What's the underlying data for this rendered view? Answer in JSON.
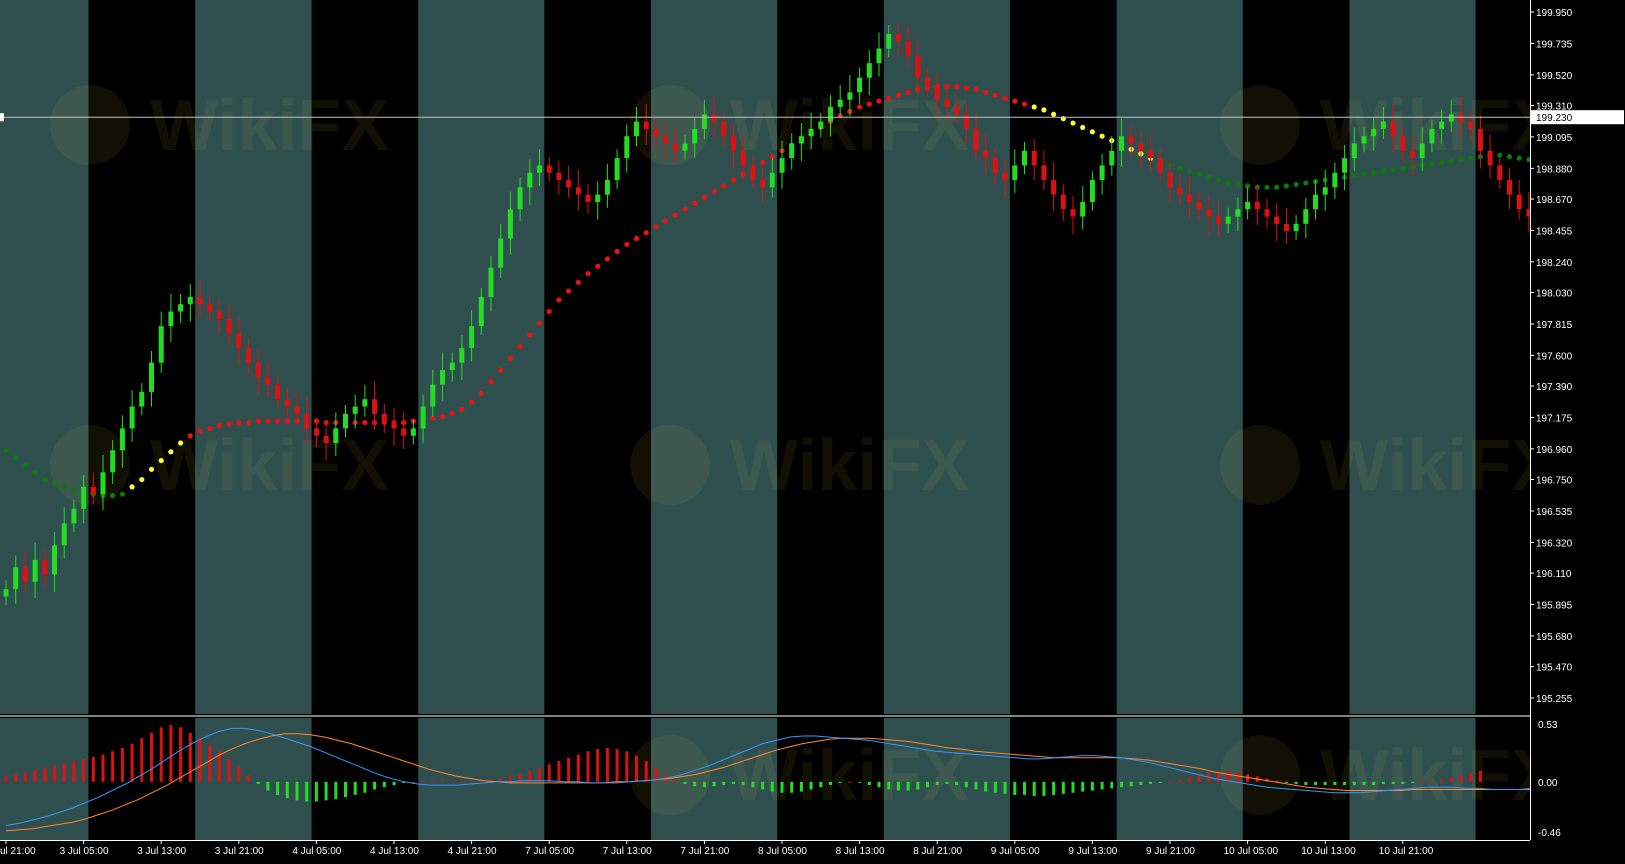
{
  "colors": {
    "session_band": "#2f4f4f",
    "off_band": "#000000",
    "bull_candle": "#22dd22",
    "bear_candle": "#dd1111",
    "trail_red": "#ee1111",
    "trail_yellow": "#ffff33",
    "trail_green": "#0a7a0a",
    "axis_text": "#ffffff",
    "macd_line": "#3399ff",
    "signal_line": "#ff8833",
    "hist_pos": "#dd1111",
    "hist_neg": "#22dd22"
  },
  "price_axis": {
    "ticks": [
      "199.950",
      "199.735",
      "199.520",
      "199.310",
      "199.095",
      "198.880",
      "198.670",
      "198.455",
      "198.240",
      "198.030",
      "197.815",
      "197.600",
      "197.390",
      "197.175",
      "196.960",
      "196.750",
      "196.535",
      "196.320",
      "196.110",
      "195.895",
      "195.680",
      "195.470",
      "195.255"
    ],
    "current_price": "199.230"
  },
  "macd_axis": {
    "ticks": [
      "0.53",
      "0.00",
      "-0.46"
    ]
  },
  "time_axis": {
    "labels": [
      "ul 21:00",
      "3 Jul 05:00",
      "3 Jul 13:00",
      "3 Jul 21:00",
      "4 Jul 05:00",
      "4 Jul 13:00",
      "4 Jul 21:00",
      "7 Jul 05:00",
      "7 Jul 13:00",
      "7 Jul 21:00",
      "8 Jul 05:00",
      "8 Jul 13:00",
      "8 Jul 21:00",
      "9 Jul 05:00",
      "9 Jul 13:00",
      "9 Jul 21:00",
      "10 Jul 05:00",
      "10 Jul 13:00",
      "10 Jul 21:00"
    ]
  },
  "watermark": "WikiFX",
  "chart_data": [
    {
      "type": "candlestick",
      "ylim": [
        195.255,
        199.95
      ],
      "current_price": 199.23,
      "x_labels": [
        "ul 21:00",
        "3 Jul 05:00",
        "3 Jul 13:00",
        "3 Jul 21:00",
        "4 Jul 05:00",
        "4 Jul 13:00",
        "4 Jul 21:00",
        "7 Jul 05:00",
        "7 Jul 13:00",
        "7 Jul 21:00",
        "8 Jul 05:00",
        "8 Jul 13:00",
        "8 Jul 21:00",
        "9 Jul 05:00",
        "9 Jul 13:00",
        "9 Jul 21:00",
        "10 Jul 05:00",
        "10 Jul 13:00",
        "10 Jul 21:00"
      ],
      "hours_per_label": 8,
      "sessions_dark": [
        [
          9,
          19
        ],
        [
          32,
          42
        ],
        [
          56,
          66
        ],
        [
          80,
          90
        ],
        [
          104,
          114
        ],
        [
          128,
          138
        ],
        [
          152,
          162
        ]
      ],
      "ohlc_close": [
        196.0,
        196.15,
        196.05,
        196.2,
        196.1,
        196.3,
        196.45,
        196.55,
        196.7,
        196.65,
        196.8,
        196.95,
        197.1,
        197.25,
        197.35,
        197.55,
        197.8,
        197.9,
        197.95,
        198.0,
        197.95,
        197.9,
        197.85,
        197.75,
        197.65,
        197.55,
        197.45,
        197.4,
        197.3,
        197.25,
        197.2,
        197.1,
        197.05,
        197.0,
        197.1,
        197.2,
        197.25,
        197.3,
        197.2,
        197.15,
        197.1,
        197.05,
        197.1,
        197.25,
        197.4,
        197.5,
        197.55,
        197.65,
        197.8,
        198.0,
        198.2,
        198.4,
        198.6,
        198.75,
        198.85,
        198.9,
        198.85,
        198.8,
        198.75,
        198.7,
        198.65,
        198.7,
        198.8,
        198.95,
        199.1,
        199.2,
        199.15,
        199.1,
        199.05,
        199.0,
        199.05,
        199.15,
        199.25,
        199.2,
        199.1,
        199.0,
        198.9,
        198.8,
        198.75,
        198.85,
        198.95,
        199.05,
        199.1,
        199.15,
        199.2,
        199.3,
        199.35,
        199.4,
        199.5,
        199.6,
        199.7,
        199.8,
        199.75,
        199.65,
        199.5,
        199.45,
        199.35,
        199.3,
        199.25,
        199.15,
        199.0,
        198.95,
        198.85,
        198.8,
        198.9,
        199.0,
        198.9,
        198.8,
        198.7,
        198.6,
        198.55,
        198.65,
        198.8,
        198.9,
        199.0,
        199.1,
        199.05,
        199.0,
        198.95,
        198.85,
        198.75,
        198.7,
        198.65,
        198.6,
        198.55,
        198.5,
        198.55,
        198.6,
        198.65,
        198.6,
        198.55,
        198.5,
        198.45,
        198.5,
        198.6,
        198.7,
        198.75,
        198.85,
        198.95,
        199.05,
        199.1,
        199.15,
        199.2,
        199.1,
        199.0,
        198.95,
        199.05,
        199.15,
        199.2,
        199.25,
        199.2,
        199.15,
        199.0,
        198.9,
        198.8,
        198.7,
        198.6,
        198.55,
        198.5,
        198.45,
        198.4,
        198.5,
        198.6,
        198.75,
        198.9,
        199.05,
        199.15,
        199.2
      ]
    },
    {
      "type": "line",
      "name": "",
      "role": "trailing-dots",
      "values": [
        196.95,
        196.9,
        196.85,
        196.8,
        196.75,
        196.72,
        196.7,
        196.67,
        196.66,
        196.65,
        196.64,
        196.64,
        196.65,
        196.7,
        196.75,
        196.82,
        196.88,
        196.94,
        197.0,
        197.05,
        197.08,
        197.1,
        197.12,
        197.13,
        197.14,
        197.14,
        197.15,
        197.15,
        197.15,
        197.15,
        197.15,
        197.15,
        197.15,
        197.14,
        197.14,
        197.14,
        197.14,
        197.14,
        197.14,
        197.14,
        197.14,
        197.14,
        197.15,
        197.16,
        197.17,
        197.18,
        197.2,
        197.23,
        197.28,
        197.34,
        197.42,
        197.5,
        197.58,
        197.66,
        197.74,
        197.82,
        197.9,
        197.98,
        198.04,
        198.1,
        198.16,
        198.21,
        198.26,
        198.31,
        198.36,
        198.4,
        198.44,
        198.48,
        198.52,
        198.56,
        198.6,
        198.64,
        198.68,
        198.72,
        198.76,
        198.8,
        198.84,
        198.88,
        198.92,
        198.96,
        199.0,
        199.04,
        199.08,
        199.12,
        199.16,
        199.2,
        199.24,
        199.27,
        199.3,
        199.32,
        199.34,
        199.36,
        199.38,
        199.4,
        199.42,
        199.43,
        199.44,
        199.44,
        199.44,
        199.43,
        199.42,
        199.4,
        199.38,
        199.36,
        199.34,
        199.32,
        199.3,
        199.28,
        199.25,
        199.22,
        199.19,
        199.16,
        199.13,
        199.1,
        199.07,
        199.04,
        199.01,
        198.98,
        198.95,
        198.92,
        198.9,
        198.88,
        198.86,
        198.84,
        198.82,
        198.8,
        198.78,
        198.77,
        198.76,
        198.75,
        198.75,
        198.75,
        198.76,
        198.77,
        198.78,
        198.79,
        198.8,
        198.81,
        198.82,
        198.83,
        198.84,
        198.85,
        198.86,
        198.87,
        198.88,
        198.89,
        198.9,
        198.91,
        198.92,
        198.93,
        198.94,
        198.95,
        198.96,
        198.97,
        198.97,
        198.96,
        198.95,
        198.94,
        198.93,
        198.92,
        198.91,
        198.9,
        198.89,
        198.88,
        198.87,
        198.86,
        198.85,
        198.84,
        198.83,
        198.82
      ],
      "color_by_segment": [
        [
          "green",
          0,
          12
        ],
        [
          "yellow",
          13,
          18
        ],
        [
          "red",
          19,
          105
        ],
        [
          "yellow",
          106,
          118
        ],
        [
          "green",
          119,
          167
        ]
      ]
    },
    {
      "type": "bar",
      "role": "macd-histogram",
      "ylim": [
        -0.46,
        0.53
      ],
      "values": [
        0.05,
        0.07,
        0.09,
        0.11,
        0.13,
        0.15,
        0.17,
        0.19,
        0.21,
        0.23,
        0.25,
        0.28,
        0.31,
        0.35,
        0.4,
        0.45,
        0.5,
        0.52,
        0.5,
        0.45,
        0.4,
        0.34,
        0.28,
        0.21,
        0.14,
        0.06,
        -0.02,
        -0.08,
        -0.12,
        -0.15,
        -0.17,
        -0.18,
        -0.18,
        -0.17,
        -0.16,
        -0.14,
        -0.12,
        -0.1,
        -0.07,
        -0.05,
        -0.03,
        -0.01,
        0.0,
        0.01,
        0.01,
        0.01,
        0.0,
        0.0,
        0.0,
        0.01,
        0.02,
        0.03,
        0.05,
        0.07,
        0.1,
        0.13,
        0.16,
        0.19,
        0.22,
        0.25,
        0.28,
        0.3,
        0.31,
        0.3,
        0.28,
        0.24,
        0.19,
        0.13,
        0.07,
        0.02,
        -0.02,
        -0.04,
        -0.05,
        -0.04,
        -0.03,
        -0.02,
        -0.03,
        -0.05,
        -0.07,
        -0.09,
        -0.1,
        -0.1,
        -0.09,
        -0.07,
        -0.05,
        -0.03,
        -0.01,
        0.0,
        -0.01,
        -0.03,
        -0.05,
        -0.07,
        -0.08,
        -0.08,
        -0.07,
        -0.05,
        -0.03,
        -0.02,
        -0.03,
        -0.05,
        -0.07,
        -0.09,
        -0.1,
        -0.11,
        -0.12,
        -0.12,
        -0.13,
        -0.13,
        -0.12,
        -0.11,
        -0.1,
        -0.09,
        -0.08,
        -0.07,
        -0.06,
        -0.05,
        -0.04,
        -0.03,
        -0.02,
        -0.01,
        0.0,
        0.02,
        0.04,
        0.06,
        0.08,
        0.09,
        0.1,
        0.09,
        0.07,
        0.05,
        0.03,
        0.01,
        -0.01,
        -0.02,
        -0.03,
        -0.03,
        -0.03,
        -0.03,
        -0.03,
        -0.03,
        -0.03,
        -0.03,
        -0.02,
        -0.02,
        -0.02,
        -0.01,
        0.0,
        0.01,
        0.02,
        0.04,
        0.06,
        0.08,
        0.1
      ],
      "macd_line": [
        -0.4,
        -0.38,
        -0.35,
        -0.32,
        -0.28,
        -0.24,
        -0.19,
        -0.14,
        -0.08,
        -0.02,
        0.05,
        0.12,
        0.2,
        0.28,
        0.35,
        0.41,
        0.46,
        0.49,
        0.49,
        0.47,
        0.44,
        0.4,
        0.36,
        0.32,
        0.27,
        0.22,
        0.17,
        0.12,
        0.07,
        0.03,
        0.0,
        -0.02,
        -0.03,
        -0.03,
        -0.03,
        -0.02,
        -0.01,
        0.0,
        0.0,
        0.01,
        0.01,
        0.01,
        0.0,
        0.0,
        -0.01,
        -0.01,
        -0.01,
        0.0,
        0.01,
        0.02,
        0.04,
        0.07,
        0.11,
        0.15,
        0.2,
        0.25,
        0.3,
        0.35,
        0.38,
        0.41,
        0.42,
        0.42,
        0.41,
        0.4,
        0.39,
        0.38,
        0.36,
        0.34,
        0.32,
        0.3,
        0.28,
        0.27,
        0.26,
        0.25,
        0.24,
        0.23,
        0.22,
        0.21,
        0.21,
        0.22,
        0.23,
        0.24,
        0.24,
        0.23,
        0.22,
        0.2,
        0.18,
        0.15,
        0.12,
        0.09,
        0.06,
        0.03,
        0.01,
        -0.01,
        -0.03,
        -0.05,
        -0.06,
        -0.07,
        -0.08,
        -0.09,
        -0.1,
        -0.1,
        -0.1,
        -0.09,
        -0.08,
        -0.07,
        -0.06,
        -0.05,
        -0.05,
        -0.05,
        -0.06,
        -0.06,
        -0.07,
        -0.07,
        -0.07,
        -0.06,
        -0.05,
        -0.04,
        -0.03,
        -0.02,
        -0.01,
        0.0,
        0.01
      ],
      "signal_line": [
        -0.45,
        -0.44,
        -0.43,
        -0.41,
        -0.39,
        -0.37,
        -0.34,
        -0.3,
        -0.26,
        -0.21,
        -0.16,
        -0.1,
        -0.04,
        0.03,
        0.1,
        0.17,
        0.24,
        0.3,
        0.35,
        0.39,
        0.42,
        0.44,
        0.44,
        0.43,
        0.41,
        0.38,
        0.35,
        0.31,
        0.27,
        0.23,
        0.19,
        0.15,
        0.11,
        0.08,
        0.05,
        0.03,
        0.01,
        0.0,
        -0.01,
        -0.01,
        -0.01,
        -0.01,
        -0.01,
        -0.01,
        -0.01,
        -0.01,
        0.0,
        0.0,
        0.01,
        0.02,
        0.03,
        0.05,
        0.07,
        0.1,
        0.13,
        0.17,
        0.21,
        0.25,
        0.29,
        0.32,
        0.35,
        0.37,
        0.39,
        0.4,
        0.4,
        0.4,
        0.39,
        0.38,
        0.37,
        0.35,
        0.33,
        0.31,
        0.3,
        0.28,
        0.27,
        0.26,
        0.25,
        0.24,
        0.23,
        0.22,
        0.22,
        0.22,
        0.22,
        0.22,
        0.22,
        0.21,
        0.2,
        0.18,
        0.16,
        0.14,
        0.12,
        0.09,
        0.07,
        0.05,
        0.03,
        0.01,
        -0.01,
        -0.03,
        -0.05,
        -0.06,
        -0.07,
        -0.08,
        -0.08,
        -0.08,
        -0.08,
        -0.08,
        -0.07,
        -0.07,
        -0.07,
        -0.07,
        -0.07,
        -0.07,
        -0.07,
        -0.07,
        -0.07,
        -0.07,
        -0.06,
        -0.06,
        -0.05,
        -0.05,
        -0.04,
        -0.03,
        -0.02
      ]
    }
  ]
}
